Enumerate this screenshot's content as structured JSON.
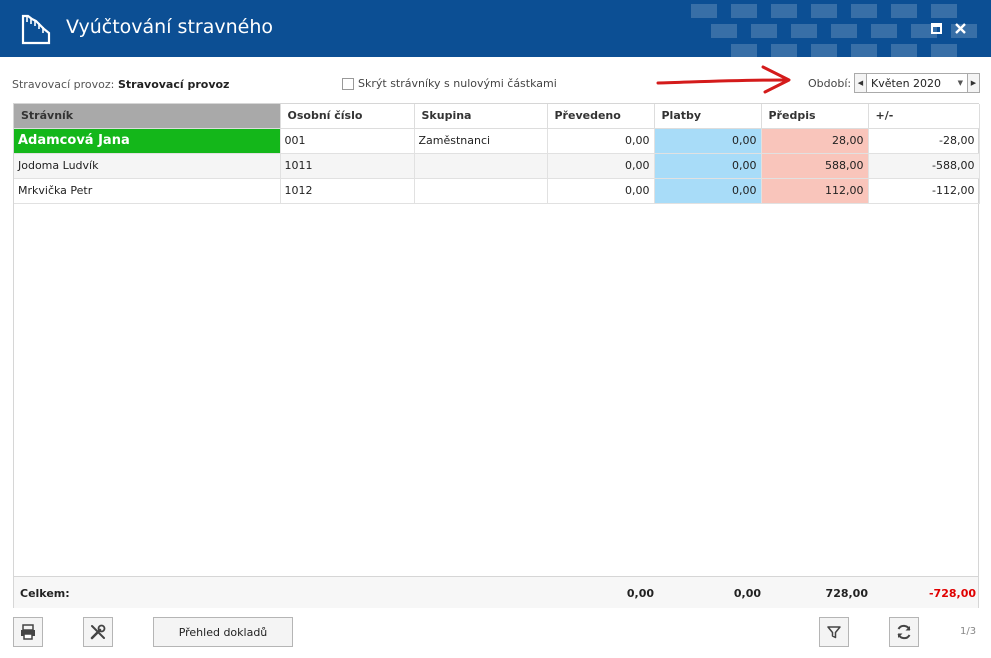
{
  "window": {
    "title": "Vyúčtování stravného",
    "app_icon": "receipt-icon",
    "maximize_icon": "maximize-icon",
    "close_icon": "close-icon"
  },
  "toolbar": {
    "provoz_label": "Stravovací provoz:",
    "provoz_value": "Stravovací provoz",
    "hide_zero_label": "Skrýt strávníky s nulovými částkami",
    "hide_zero_checked": false,
    "period_label": "Období:",
    "period_value": "Květen 2020"
  },
  "grid": {
    "columns": [
      "Strávník",
      "Osobní číslo",
      "Skupina",
      "Převedeno",
      "Platby",
      "Předpis",
      "+/-"
    ],
    "rows": [
      {
        "stravnik": "Adamcová Jana",
        "cislo": "001",
        "skupina": "Zaměstnanci",
        "prevedeno": "0,00",
        "platby": "0,00",
        "predpis": "28,00",
        "rozdil": "-28,00"
      },
      {
        "stravnik": "Jodoma Ludvík",
        "cislo": "1011",
        "skupina": "",
        "prevedeno": "0,00",
        "platby": "0,00",
        "predpis": "588,00",
        "rozdil": "-588,00"
      },
      {
        "stravnik": "Mrkvička Petr",
        "cislo": "1012",
        "skupina": "",
        "prevedeno": "0,00",
        "platby": "0,00",
        "predpis": "112,00",
        "rozdil": "-112,00"
      }
    ],
    "totals": {
      "label": "Celkem:",
      "prevedeno": "0,00",
      "platby": "0,00",
      "predpis": "728,00",
      "rozdil": "-728,00"
    }
  },
  "bottom": {
    "print_icon": "print-icon",
    "tools_icon": "tools-icon",
    "overview_label": "Přehled dokladů",
    "filter_icon": "filter-icon",
    "refresh_icon": "refresh-icon",
    "pager": "1/3"
  },
  "colors": {
    "title_bar": "#0c4f94",
    "selected_row": "#14b71a",
    "payments": "#a8dcf8",
    "prescription": "#f9c5bb",
    "negative": "#e00000",
    "annotation_arrow": "#d41b1b"
  }
}
